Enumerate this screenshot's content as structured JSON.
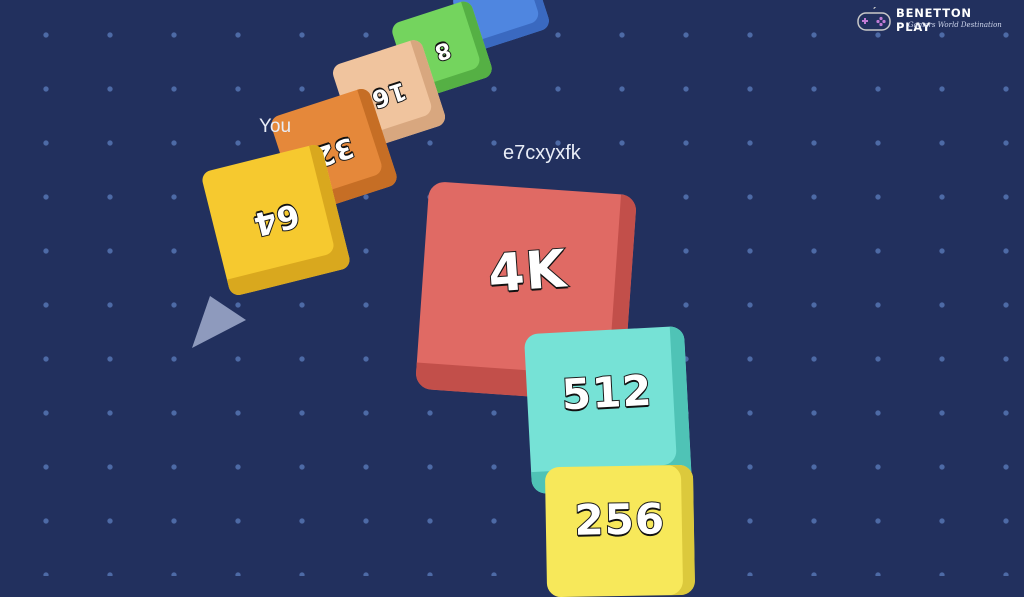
{
  "colors": {
    "background": "#22305e",
    "dot": "#4d6aa6",
    "pointer": "#9aa6c8"
  },
  "brand": {
    "name": "BENETTON PLAY",
    "tagline": "Gamers World Destination",
    "icon": "gamepad-icon"
  },
  "player": {
    "name_label": "You",
    "cubes": [
      {
        "value": "64",
        "color": "#f6c92f",
        "side": "#d9a81e"
      },
      {
        "value": "32",
        "color": "#e5883a",
        "side": "#c66e25"
      },
      {
        "value": "16",
        "color": "#f0c49e",
        "side": "#d8a77f"
      },
      {
        "value": "8",
        "color": "#74d45e",
        "side": "#55b044"
      },
      {
        "value": "",
        "color": "#4f86e0",
        "side": "#3a69c0"
      }
    ]
  },
  "opponent": {
    "name_label": "e7cxyxfk",
    "cubes": [
      {
        "value": "4K",
        "color": "#e06a64",
        "side": "#c24f4a"
      },
      {
        "value": "512",
        "color": "#76e2d6",
        "side": "#4fc3b6"
      },
      {
        "value": "256",
        "color": "#f7e85a",
        "side": "#dcc93c"
      }
    ]
  },
  "direction_pointer": "direction-arrow-icon"
}
